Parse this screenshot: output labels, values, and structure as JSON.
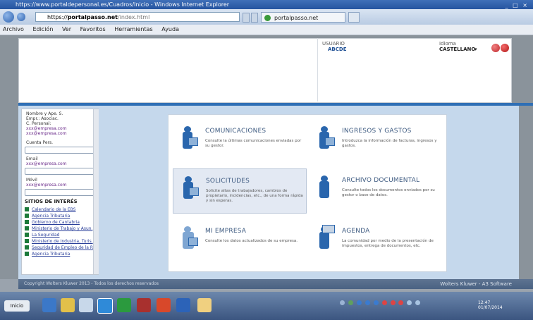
{
  "window": {
    "title": "https://www.portaldepersonal.es/Cuadros/Inicio - Windows Internet Explorer",
    "controls": "_ □ ×"
  },
  "browser": {
    "url_lead": "https://",
    "url_domain": "portalpasso.net",
    "url_rest": "/index.html",
    "tab_label": "portalpasso.net",
    "menu": [
      "Archivo",
      "Edición",
      "Ver",
      "Favoritos",
      "Herramientas",
      "Ayuda"
    ]
  },
  "header": {
    "user_label": "USUARIO",
    "user_value": "ABCDE",
    "language_label": "Idioma",
    "language_value": "CASTELLANO"
  },
  "sidebar": {
    "info_lines": [
      "Nombre y Ape. S.",
      "Empr.: Asociac.",
      "C. Personal:"
    ],
    "info_links": [
      "xxx@empresa.com",
      "xxx@empresa.com"
    ],
    "field1_label": "Cuenta Pers.",
    "field2_label": "Email",
    "field2_link": "xxx@empresa.com",
    "field3_label": "Móvil",
    "field3_link": "xxx@empresa.com",
    "sites_heading": "SITIOS DE INTERÉS",
    "sites": [
      "Calendario de la EBS",
      "Agencia Tributaria",
      "Gobierno de Cantabria",
      "Ministerio de Trabajo y Asun.",
      "La Seguridad",
      "Ministerio de Industria, Turis.",
      "Seguridad de Empleo de la R.",
      "Agencia Tributaria"
    ]
  },
  "tiles": [
    {
      "title": "COMUNICACIONES",
      "desc": "Consulte la últimas comunicaciones enviadas por su gestor."
    },
    {
      "title": "INGRESOS Y GASTOS",
      "desc": "Introduzca la información de facturas, ingresos y gastos."
    },
    {
      "title": "SOLICITUDES",
      "desc": "Solicite altas de trabajadores, cambios de propietario, incidencias, etc., de una forma rápida y sin esperas."
    },
    {
      "title": "ARCHIVO DOCUMENTAL",
      "desc": "Consulte todos los documentos enviados por su gestor o base de datos."
    },
    {
      "title": "MI EMPRESA",
      "desc": "Consulte los datos actualizados de su empresa."
    },
    {
      "title": "AGENDA",
      "desc": "La comunidad por medio de la presentación de impuestos, entrega de documentos, etc."
    }
  ],
  "footer": {
    "left": "Copyright Wolters Kluwer 2013 - Todos los derechos reservados",
    "right": "Wolters Kluwer - A3 Software"
  },
  "taskbar": {
    "start_label": "Inicio",
    "clock": "12:47\n01/07/2014"
  },
  "colors": {
    "accent": "#2f6fb5",
    "icon_blue": "#2a66ad",
    "tile_title": "#3d5a80"
  }
}
